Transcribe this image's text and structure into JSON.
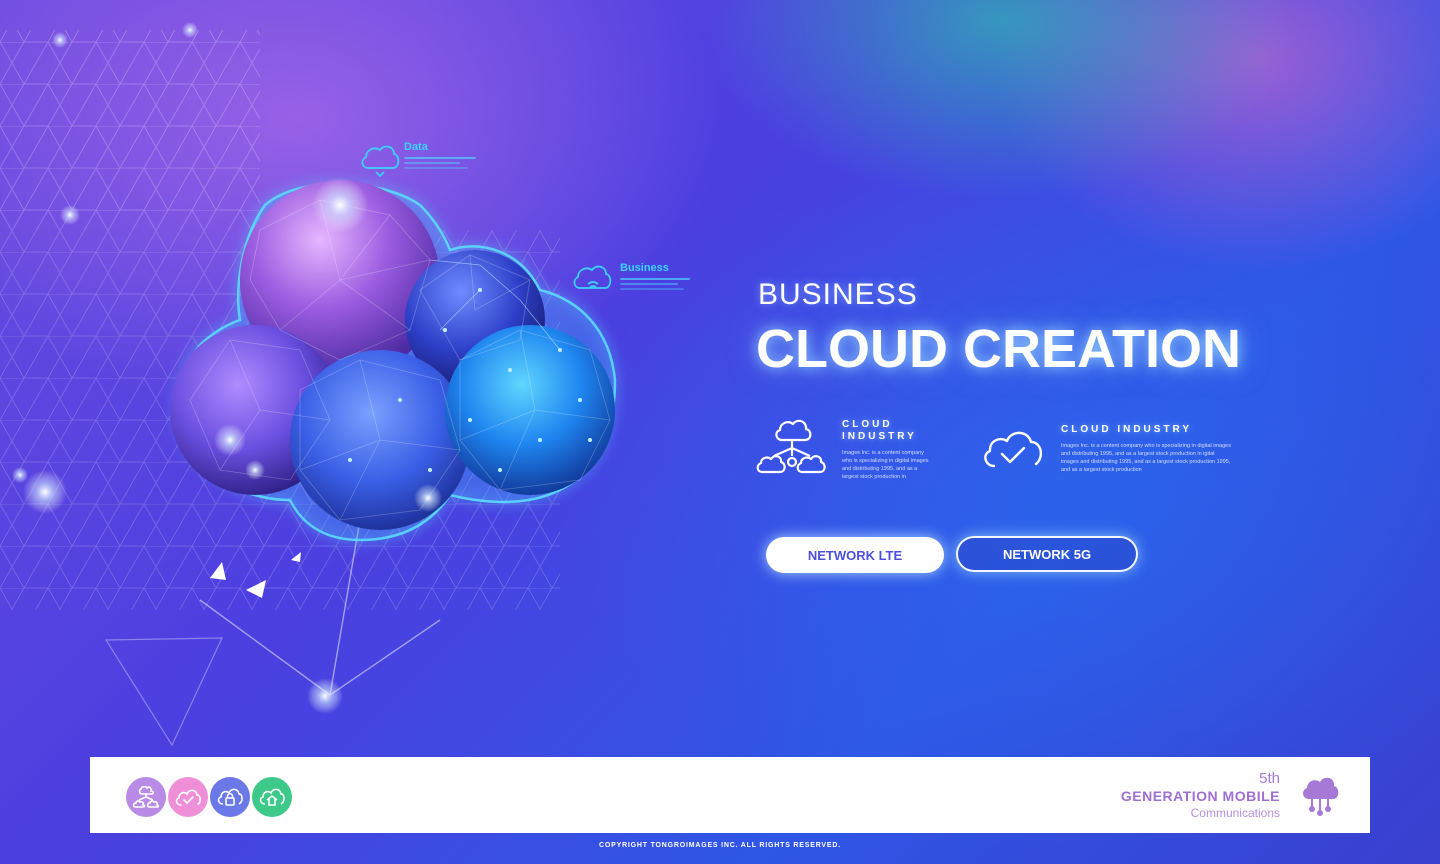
{
  "hero": {
    "kicker": "BUSINESS",
    "title": "CLOUD CREATION"
  },
  "floating_tags": {
    "data": "Data",
    "business": "Business"
  },
  "features": [
    {
      "title_line1": "CLOUD",
      "title_line2": "INDUSTRY",
      "description": "Images Inc. is a content company who is specializing in digital images and distributing 1995, and as a largest stock production in",
      "icon": "network-cloud-icon"
    },
    {
      "title": "CLOUD INDUSTRY",
      "description": "Images Inc. is a content company who is specializing in digital images and distributing 1995, and as a largest stock production in igital images and distributing 1995, and as a largest stock production 1995, and as a largest stock production",
      "icon": "cloud-check-icon"
    }
  ],
  "buttons": {
    "lte": "NETWORK LTE",
    "g5": "NETWORK 5G"
  },
  "footer": {
    "circles": [
      {
        "icon": "network-cloud-icon",
        "color": "#b98be6"
      },
      {
        "icon": "cloud-check-icon",
        "color": "#ee8fd8"
      },
      {
        "icon": "cloud-lock-icon",
        "color": "#6b78e8"
      },
      {
        "icon": "cloud-home-icon",
        "color": "#3cc98a"
      }
    ],
    "brand_5th": "5th",
    "brand_generation": "GENERATION MOBILE",
    "brand_communications": "Communications",
    "brand_icon": "cloud-network-icon"
  },
  "copyright": "COPYRIGHT TONGROIMAGES INC. ALL RIGHTS RESERVED.",
  "colors": {
    "accent_cyan": "#39d3ff",
    "button_text": "#4d4fe0",
    "brand_purple": "#9f6fd1"
  }
}
